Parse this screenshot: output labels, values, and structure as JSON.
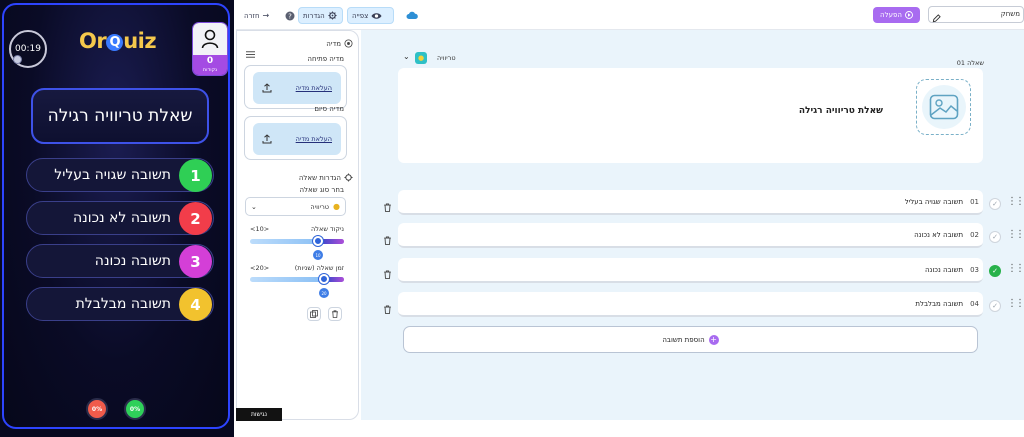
{
  "preview": {
    "timer": "00:19",
    "logo_pre": "Or",
    "logo_q": "Q",
    "logo_post": "uiz",
    "score": "0",
    "score_label": "נקודות",
    "question": "שאלת טריוויה רגילה",
    "answers": [
      {
        "num": "1",
        "text": "תשובה שגויה בעליל",
        "color": "#2fcf55"
      },
      {
        "num": "2",
        "text": "תשובה לא נכונה",
        "color": "#f23d4a"
      },
      {
        "num": "3",
        "text": "תשובה נכונה",
        "color": "#d43fd7"
      },
      {
        "num": "4",
        "text": "תשובה מבלבלת",
        "color": "#f2c22e"
      }
    ],
    "pct_left": "0%",
    "pct_right": "0%",
    "pct_left_color": "#f05b4b",
    "pct_right_color": "#2fd05a"
  },
  "topbar": {
    "back": "חזרה",
    "settings": "הגדרות",
    "preview": "צפייה",
    "start": "הפעלה",
    "name_value": "משחק"
  },
  "settings": {
    "media_header": "מדיה",
    "opening_media": "מדיה פתיחה",
    "end_media": "מדיה סיום",
    "upload_label": "העלאת מדיה",
    "question_settings": "הגדרות שאלה",
    "choose_type": "בחר סוג שאלה",
    "type_value": "טריוויה",
    "score_label": "ניקוד שאלה",
    "score_value": "<10>",
    "score_thumb": "10",
    "time_label": "זמן שאלה (שניות)",
    "time_value": "<20>",
    "time_thumb": "20",
    "access_tab": "נגישות"
  },
  "main": {
    "type_label": "טריוויה",
    "question_num": "שאלה 01",
    "question_title": "שאלת טריוויה רגילה",
    "answers": [
      {
        "num": "01",
        "text": "תשובה שגויה בעליל",
        "correct": false
      },
      {
        "num": "02",
        "text": "תשובה לא נכונה",
        "correct": false
      },
      {
        "num": "03",
        "text": "תשובה נכונה",
        "correct": true
      },
      {
        "num": "04",
        "text": "תשובה מבלבלת",
        "correct": false
      }
    ],
    "add_answer": "הוספת תשובה"
  }
}
